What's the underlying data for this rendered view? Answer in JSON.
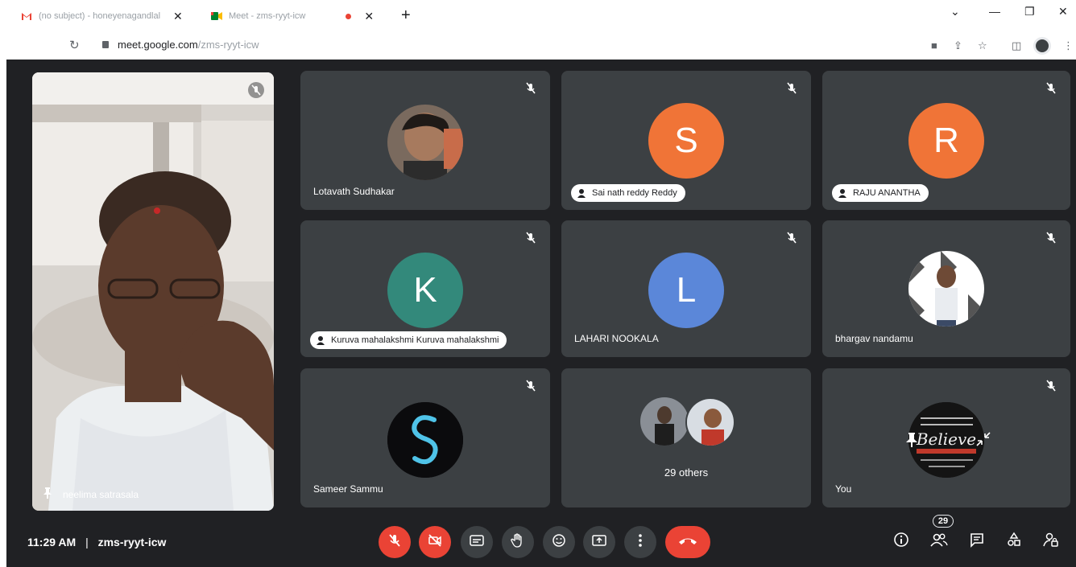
{
  "browser": {
    "tabs": [
      {
        "title": "(no subject) - honeyenagandlal",
        "icon": "gmail-icon",
        "active": false
      },
      {
        "title": "Meet - zms-ryyt-icw",
        "icon": "meet-icon",
        "active": true
      }
    ],
    "new_tab": "+",
    "url_host": "meet.google.com",
    "url_path": "/zms-ryyt-icw"
  },
  "colors": {
    "meet_bg": "#202124",
    "tile_bg": "#3c4043",
    "red": "#ea4335",
    "orange": "#f07437",
    "teal": "#33897b",
    "blue": "#5b87d9"
  },
  "featured": {
    "name": "neelima satrasala"
  },
  "tiles": [
    {
      "name": "Lotavath Sudhakar",
      "avatar_type": "photo",
      "pinned": false
    },
    {
      "name": "Sai nath reddy Reddy",
      "avatar_letter": "S",
      "avatar_color": "#f07437",
      "pinned": true
    },
    {
      "name": "RAJU ANANTHA",
      "avatar_letter": "R",
      "avatar_color": "#f07437",
      "pinned": true
    },
    {
      "name": "Kuruva mahalakshmi Kuruva mahalakshmi",
      "avatar_letter": "K",
      "avatar_color": "#33897b",
      "pinned": true
    },
    {
      "name": "LAHARI NOOKALA",
      "avatar_letter": "L",
      "avatar_color": "#5b87d9",
      "pinned": false
    },
    {
      "name": "bhargav nandamu",
      "avatar_type": "photo",
      "pinned": false
    },
    {
      "name": "Sameer Sammu",
      "avatar_type": "logo",
      "pinned": false
    },
    {
      "name": "29 others",
      "avatar_type": "group",
      "pinned": false
    },
    {
      "name": "You",
      "avatar_type": "photo",
      "pinned": false
    }
  ],
  "self_tile_text": "Believe",
  "bottom": {
    "time": "11:29 AM",
    "separator": "|",
    "meeting_code": "zms-ryyt-icw",
    "participant_count": "29"
  }
}
